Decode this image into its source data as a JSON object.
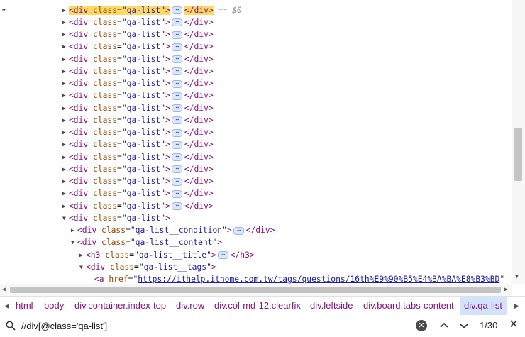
{
  "tree": {
    "more_icon": "ellipsis-icon",
    "selected_marker": "== $0",
    "ellipsis_text": "⋯",
    "rows": [
      {
        "indent": 0,
        "tag": "div",
        "attr": "class",
        "value": "qa-list",
        "collapsed": true,
        "close": "</div>",
        "selected": true
      },
      {
        "indent": 0,
        "tag": "div",
        "attr": "class",
        "value": "qa-list",
        "collapsed": true,
        "close": "</div>"
      },
      {
        "indent": 0,
        "tag": "div",
        "attr": "class",
        "value": "qa-list",
        "collapsed": true,
        "close": "</div>"
      },
      {
        "indent": 0,
        "tag": "div",
        "attr": "class",
        "value": "qa-list",
        "collapsed": true,
        "close": "</div>"
      },
      {
        "indent": 0,
        "tag": "div",
        "attr": "class",
        "value": "qa-list",
        "collapsed": true,
        "close": "</div>"
      },
      {
        "indent": 0,
        "tag": "div",
        "attr": "class",
        "value": "qa-list",
        "collapsed": true,
        "close": "</div>"
      },
      {
        "indent": 0,
        "tag": "div",
        "attr": "class",
        "value": "qa-list",
        "collapsed": true,
        "close": "</div>"
      },
      {
        "indent": 0,
        "tag": "div",
        "attr": "class",
        "value": "qa-list",
        "collapsed": true,
        "close": "</div>"
      },
      {
        "indent": 0,
        "tag": "div",
        "attr": "class",
        "value": "qa-list",
        "collapsed": true,
        "close": "</div>"
      },
      {
        "indent": 0,
        "tag": "div",
        "attr": "class",
        "value": "qa-list",
        "collapsed": true,
        "close": "</div>"
      },
      {
        "indent": 0,
        "tag": "div",
        "attr": "class",
        "value": "qa-list",
        "collapsed": true,
        "close": "</div>"
      },
      {
        "indent": 0,
        "tag": "div",
        "attr": "class",
        "value": "qa-list",
        "collapsed": true,
        "close": "</div>"
      },
      {
        "indent": 0,
        "tag": "div",
        "attr": "class",
        "value": "qa-list",
        "collapsed": true,
        "close": "</div>"
      },
      {
        "indent": 0,
        "tag": "div",
        "attr": "class",
        "value": "qa-list",
        "collapsed": true,
        "close": "</div>"
      },
      {
        "indent": 0,
        "tag": "div",
        "attr": "class",
        "value": "qa-list",
        "collapsed": true,
        "close": "</div>"
      },
      {
        "indent": 0,
        "tag": "div",
        "attr": "class",
        "value": "qa-list",
        "collapsed": true,
        "close": "</div>"
      },
      {
        "indent": 0,
        "tag": "div",
        "attr": "class",
        "value": "qa-list",
        "collapsed": true,
        "close": "</div>"
      },
      {
        "indent": 0,
        "tag": "div",
        "attr": "class",
        "value": "qa-list",
        "expanded": true
      },
      {
        "indent": 1,
        "tag": "div",
        "attr": "class",
        "value": "qa-list__condition",
        "collapsed": true,
        "close": "</div>"
      },
      {
        "indent": 1,
        "tag": "div",
        "attr": "class",
        "value": "qa-list__content",
        "expanded": true
      },
      {
        "indent": 2,
        "tag": "h3",
        "attr": "class",
        "value": "qa-list__title",
        "collapsed": true,
        "close": "</h3>"
      },
      {
        "indent": 2,
        "tag": "div",
        "attr": "class",
        "value": "qa-list__tags",
        "expanded": true
      },
      {
        "indent": 3,
        "tag": "a",
        "attr": "href",
        "value": "https://ithelp.ithome.com.tw/tags/questions/16th%E9%90%B5%E4%BA%BA%E8%B3%BD",
        "partial": true
      }
    ]
  },
  "breadcrumbs": {
    "items": [
      "html",
      "body",
      "div.container.index-top",
      "div.row",
      "div.col-md-12.clearfix",
      "div.leftside",
      "div.board.tabs-content",
      "div.qa-list"
    ],
    "active_index": 7
  },
  "search": {
    "value": "//div[@class='qa-list']",
    "clear_icon": "clear-icon",
    "match_count": "1/30",
    "close_icon": "close-icon"
  },
  "colors": {
    "tag": "#881280",
    "attr_name": "#994500",
    "attr_value": "#1a1aa6",
    "selected_highlight": "#ffd966",
    "active_crumb": "#d3e3fd"
  }
}
